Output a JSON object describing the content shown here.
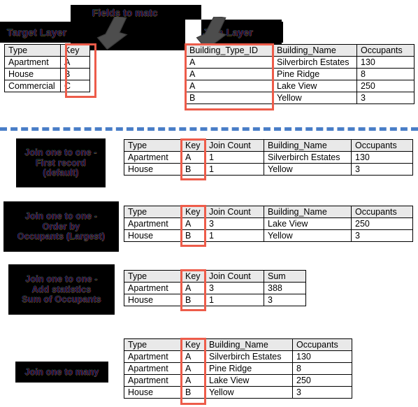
{
  "diagram": {
    "title": "Spatial join field matching and join operation results",
    "accent_red": "#ed5c4a",
    "divider_blue": "#4a7ec7"
  },
  "captions": {
    "target_layer": "Target Layer",
    "fields_to_match": "Fields to match",
    "join_layer": "Join Layer",
    "one_to_one_first": [
      "Join one to one -",
      "First record",
      "(default)"
    ],
    "one_to_one_order": [
      "Join one to one -",
      "Order by",
      "Occupants (Largest)"
    ],
    "one_to_one_stats": [
      "Join one to one -",
      "Add statistics",
      "Sum of Occupants"
    ],
    "one_to_many": [
      "Join one to many"
    ]
  },
  "tables": {
    "target": {
      "headers": [
        "Type",
        "Key"
      ],
      "rows": [
        [
          "Apartment",
          "A"
        ],
        [
          "House",
          "B"
        ],
        [
          "Commercial",
          "C"
        ]
      ]
    },
    "join": {
      "headers": [
        "Building_Type_ID",
        "Building_Name",
        "Occupants"
      ],
      "rows": [
        [
          "A",
          "Silverbirch Estates",
          "130"
        ],
        [
          "A",
          "Pine Ridge",
          "8"
        ],
        [
          "A",
          "Lake View",
          "250"
        ],
        [
          "B",
          "Yellow",
          "3"
        ]
      ]
    },
    "result_first": {
      "headers": [
        "Type",
        "Key",
        "Join Count",
        "Building_Name",
        "Occupants"
      ],
      "rows": [
        [
          "Apartment",
          "A",
          "1",
          "Silverbirch Estates",
          "130"
        ],
        [
          "House",
          "B",
          "1",
          "Yellow",
          "3"
        ]
      ]
    },
    "result_order": {
      "headers": [
        "Type",
        "Key",
        "Join Count",
        "Building_Name",
        "Occupants"
      ],
      "rows": [
        [
          "Apartment",
          "A",
          "3",
          "Lake View",
          "250"
        ],
        [
          "House",
          "B",
          "1",
          "Yellow",
          "3"
        ]
      ]
    },
    "result_stats": {
      "headers": [
        "Type",
        "Key",
        "Join Count",
        "Sum"
      ],
      "rows": [
        [
          "Apartment",
          "A",
          "3",
          "388"
        ],
        [
          "House",
          "B",
          "1",
          "3"
        ]
      ]
    },
    "result_many": {
      "headers": [
        "Type",
        "Key",
        "Building_Name",
        "Occupants"
      ],
      "rows": [
        [
          "Apartment",
          "A",
          "Silverbirch Estates",
          "130"
        ],
        [
          "Apartment",
          "A",
          "Pine Ridge",
          "8"
        ],
        [
          "Apartment",
          "A",
          "Lake View",
          "250"
        ],
        [
          "House",
          "B",
          "Yellow",
          "3"
        ]
      ]
    }
  }
}
